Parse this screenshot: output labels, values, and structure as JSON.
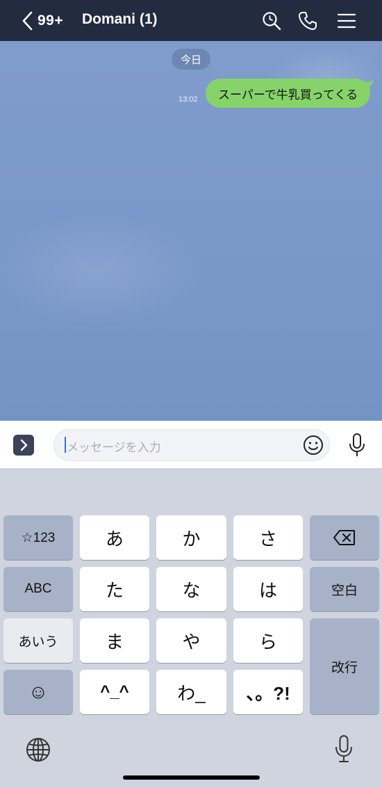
{
  "header": {
    "back_count": "99+",
    "title": "Domani (1)",
    "icons": [
      "chevron-left-icon",
      "search-icon",
      "phone-icon",
      "menu-icon"
    ]
  },
  "chat": {
    "date_label": "今日",
    "messages": [
      {
        "time": "13:02",
        "text": "スーパーで牛乳買ってくる",
        "sender": "me"
      }
    ]
  },
  "composer": {
    "placeholder": "メッセージを入力",
    "icons": [
      "expand-arrow-icon",
      "emoji-icon",
      "microphone-icon"
    ]
  },
  "keyboard": {
    "left_column": [
      "☆123",
      "ABC",
      "あいう",
      "☺"
    ],
    "kana_rows": [
      [
        "あ",
        "か",
        "さ"
      ],
      [
        "た",
        "な",
        "は"
      ],
      [
        "ま",
        "や",
        "ら"
      ],
      [
        "^_^",
        "わ_",
        "、。?!"
      ]
    ],
    "right_column": {
      "delete_icon": "backspace-icon",
      "space": "空白",
      "return": "改行"
    },
    "bottom_icons": [
      "globe-icon",
      "dictation-microphone-icon"
    ]
  },
  "colors": {
    "header_bg": "#232b41",
    "chat_bg": "#7a98c9",
    "bubble_green": "#86d36a",
    "key_dark": "#a7b2c8"
  }
}
